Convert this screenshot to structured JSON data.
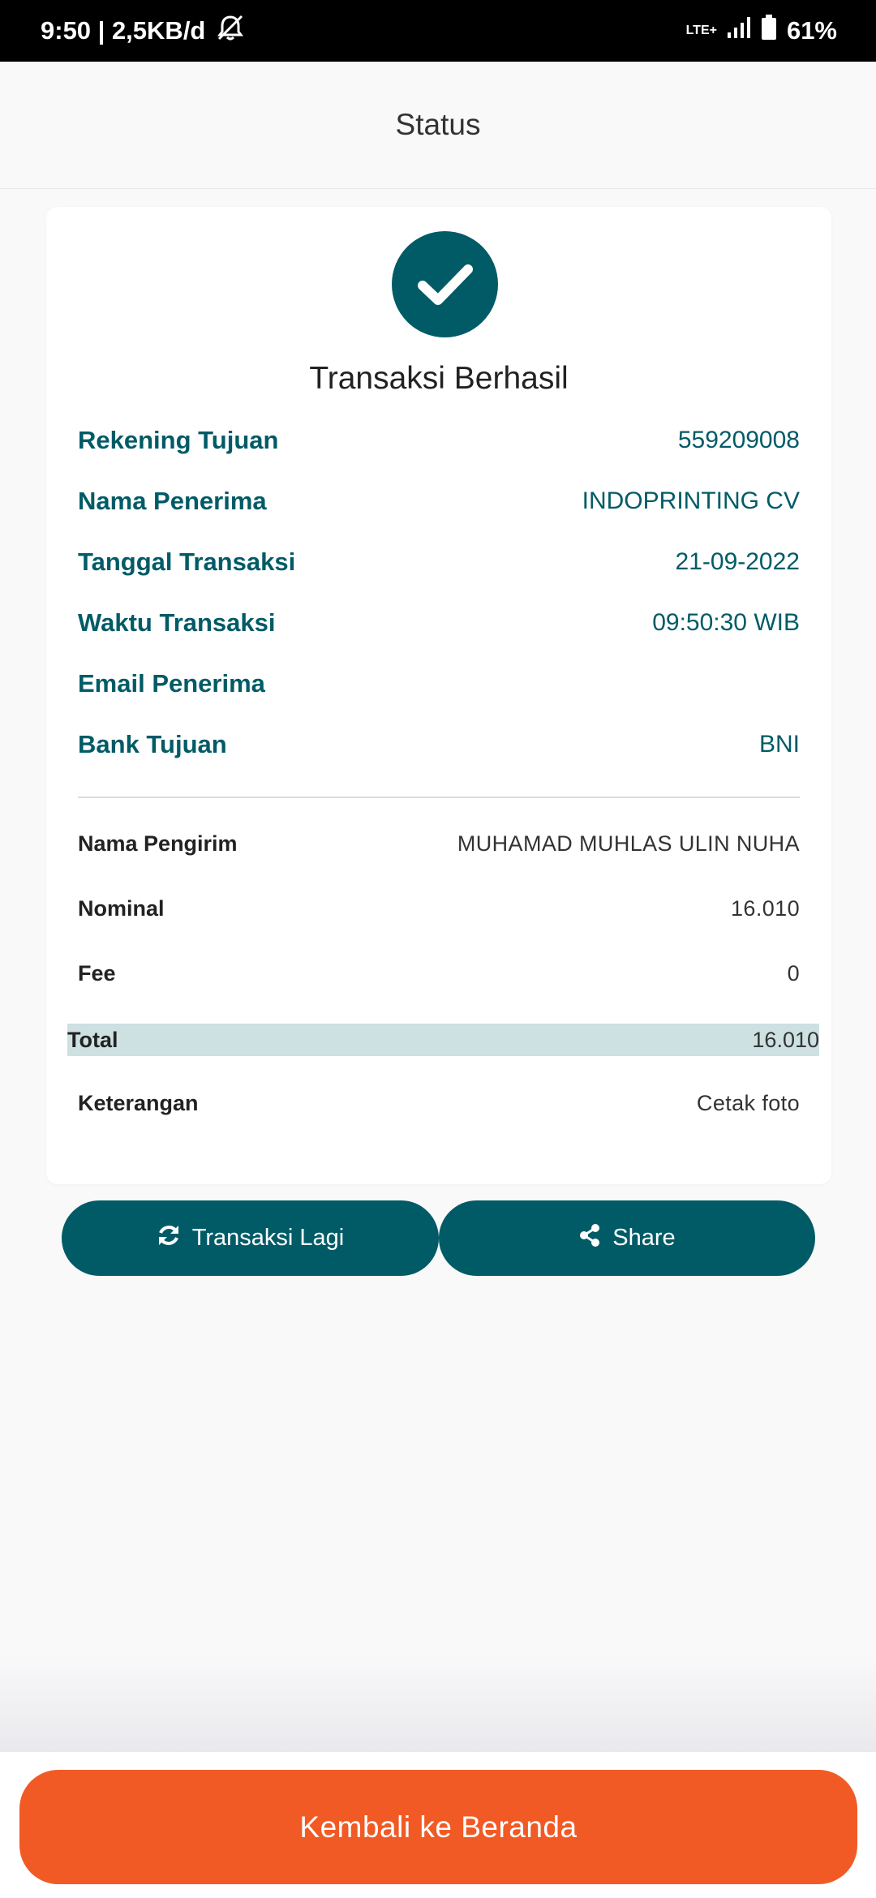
{
  "status_bar": {
    "time_speed": "9:50 | 2,5KB/d",
    "network": "LTE+",
    "battery": "61%"
  },
  "header": {
    "title": "Status"
  },
  "result": {
    "title": "Transaksi Berhasil"
  },
  "details": [
    {
      "label": "Rekening Tujuan",
      "value": "559209008"
    },
    {
      "label": "Nama Penerima",
      "value": "INDOPRINTING CV"
    },
    {
      "label": "Tanggal Transaksi",
      "value": "21-09-2022"
    },
    {
      "label": "Waktu Transaksi",
      "value": "09:50:30 WIB"
    },
    {
      "label": "Email Penerima",
      "value": ""
    },
    {
      "label": "Bank Tujuan",
      "value": "BNI"
    }
  ],
  "summary": [
    {
      "label": "Nama Pengirim",
      "value": "MUHAMAD MUHLAS ULIN NUHA"
    },
    {
      "label": "Nominal",
      "value": "16.010"
    },
    {
      "label": "Fee",
      "value": "0"
    }
  ],
  "total": {
    "label": "Total",
    "value": "16.010"
  },
  "note": {
    "label": "Keterangan",
    "value": "Cetak foto"
  },
  "buttons": {
    "again_label": "Transaksi Lagi",
    "share_label": "Share",
    "home_label": "Kembali ke Beranda"
  },
  "icons": {
    "success": "check-icon",
    "again": "refresh-icon",
    "share": "share-icon",
    "mute": "mute-icon",
    "signal": "signal-icon",
    "battery": "battery-icon"
  },
  "colors": {
    "primary": "#005b66",
    "accent": "#f15a24",
    "total_highlight": "#cde0e2"
  }
}
